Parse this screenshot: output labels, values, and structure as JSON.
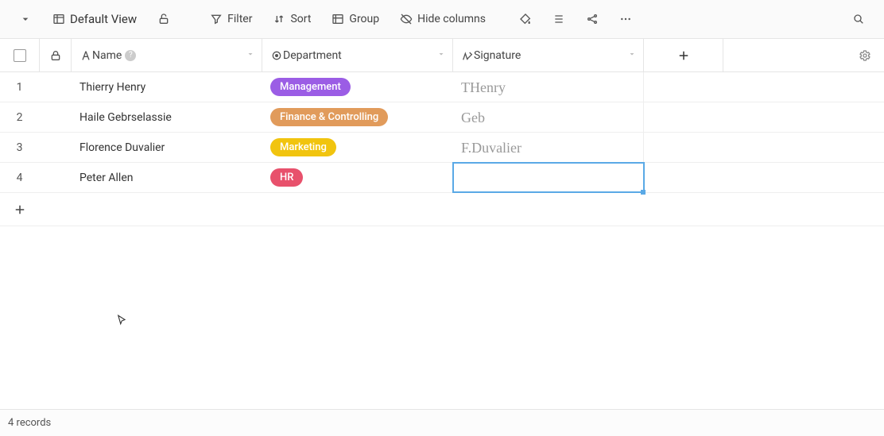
{
  "toolbar": {
    "view_label": "Default View",
    "filter_label": "Filter",
    "sort_label": "Sort",
    "group_label": "Group",
    "hide_cols_label": "Hide columns"
  },
  "columns": {
    "name": "Name",
    "department": "Department",
    "signature": "Signature"
  },
  "pill_colors": {
    "Management": "#9b5de5",
    "Finance & Controlling": "#e19b5b",
    "Marketing": "#f1c40f",
    "HR": "#e8516c"
  },
  "rows": [
    {
      "idx": "1",
      "name": "Thierry Henry",
      "department": "Management",
      "signature": "THenry"
    },
    {
      "idx": "2",
      "name": "Haile Gebrselassie",
      "department": "Finance & Controlling",
      "signature": "Geb"
    },
    {
      "idx": "3",
      "name": "Florence Duvalier",
      "department": "Marketing",
      "signature": "F.Duvalier"
    },
    {
      "idx": "4",
      "name": "Peter Allen",
      "department": "HR",
      "signature": ""
    }
  ],
  "selected_cell": {
    "row": 3,
    "col": "signature"
  },
  "footer": {
    "records_label": "4 records"
  }
}
